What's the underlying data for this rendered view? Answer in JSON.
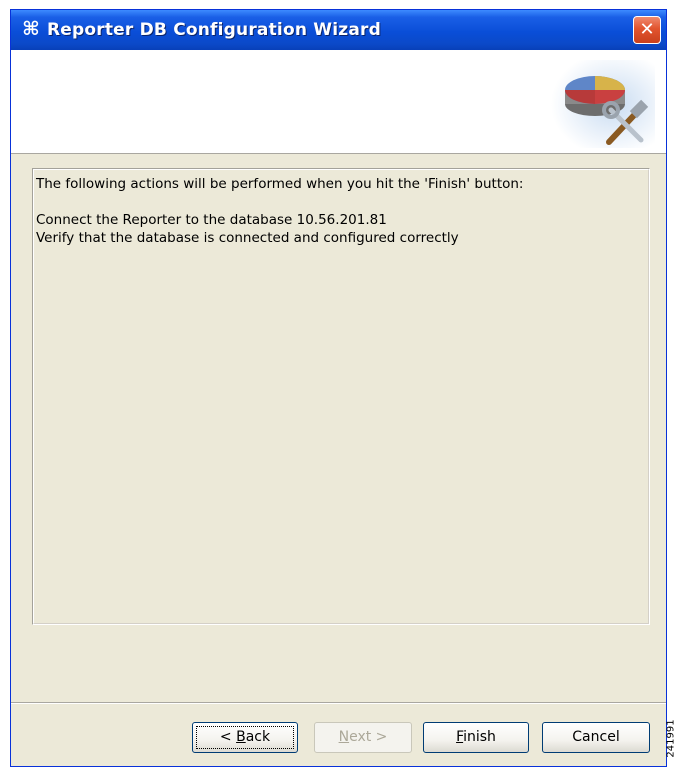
{
  "window": {
    "title": "Reporter DB Configuration Wizard",
    "title_icon": "⌘",
    "close_label": "✕"
  },
  "banner": {
    "icon": "database-tools-icon"
  },
  "content": {
    "lines": [
      "The following actions will be performed when you hit the 'Finish' button:",
      "Connect the Reporter to the database 10.56.201.81",
      "Verify that the database is connected and configured correctly"
    ]
  },
  "buttons": {
    "back_prefix": "< ",
    "back_mnemonic": "B",
    "back_rest": "ack",
    "next_mnemonic": "N",
    "next_rest": "ext >",
    "finish_mnemonic": "F",
    "finish_rest": "inish",
    "cancel_label": "Cancel"
  },
  "side_label": "241991",
  "colors": {
    "titlebar": "#0a4ed8",
    "close_button": "#e2542e",
    "dialog_background": "#ece9d8",
    "button_border": "#003c74"
  }
}
